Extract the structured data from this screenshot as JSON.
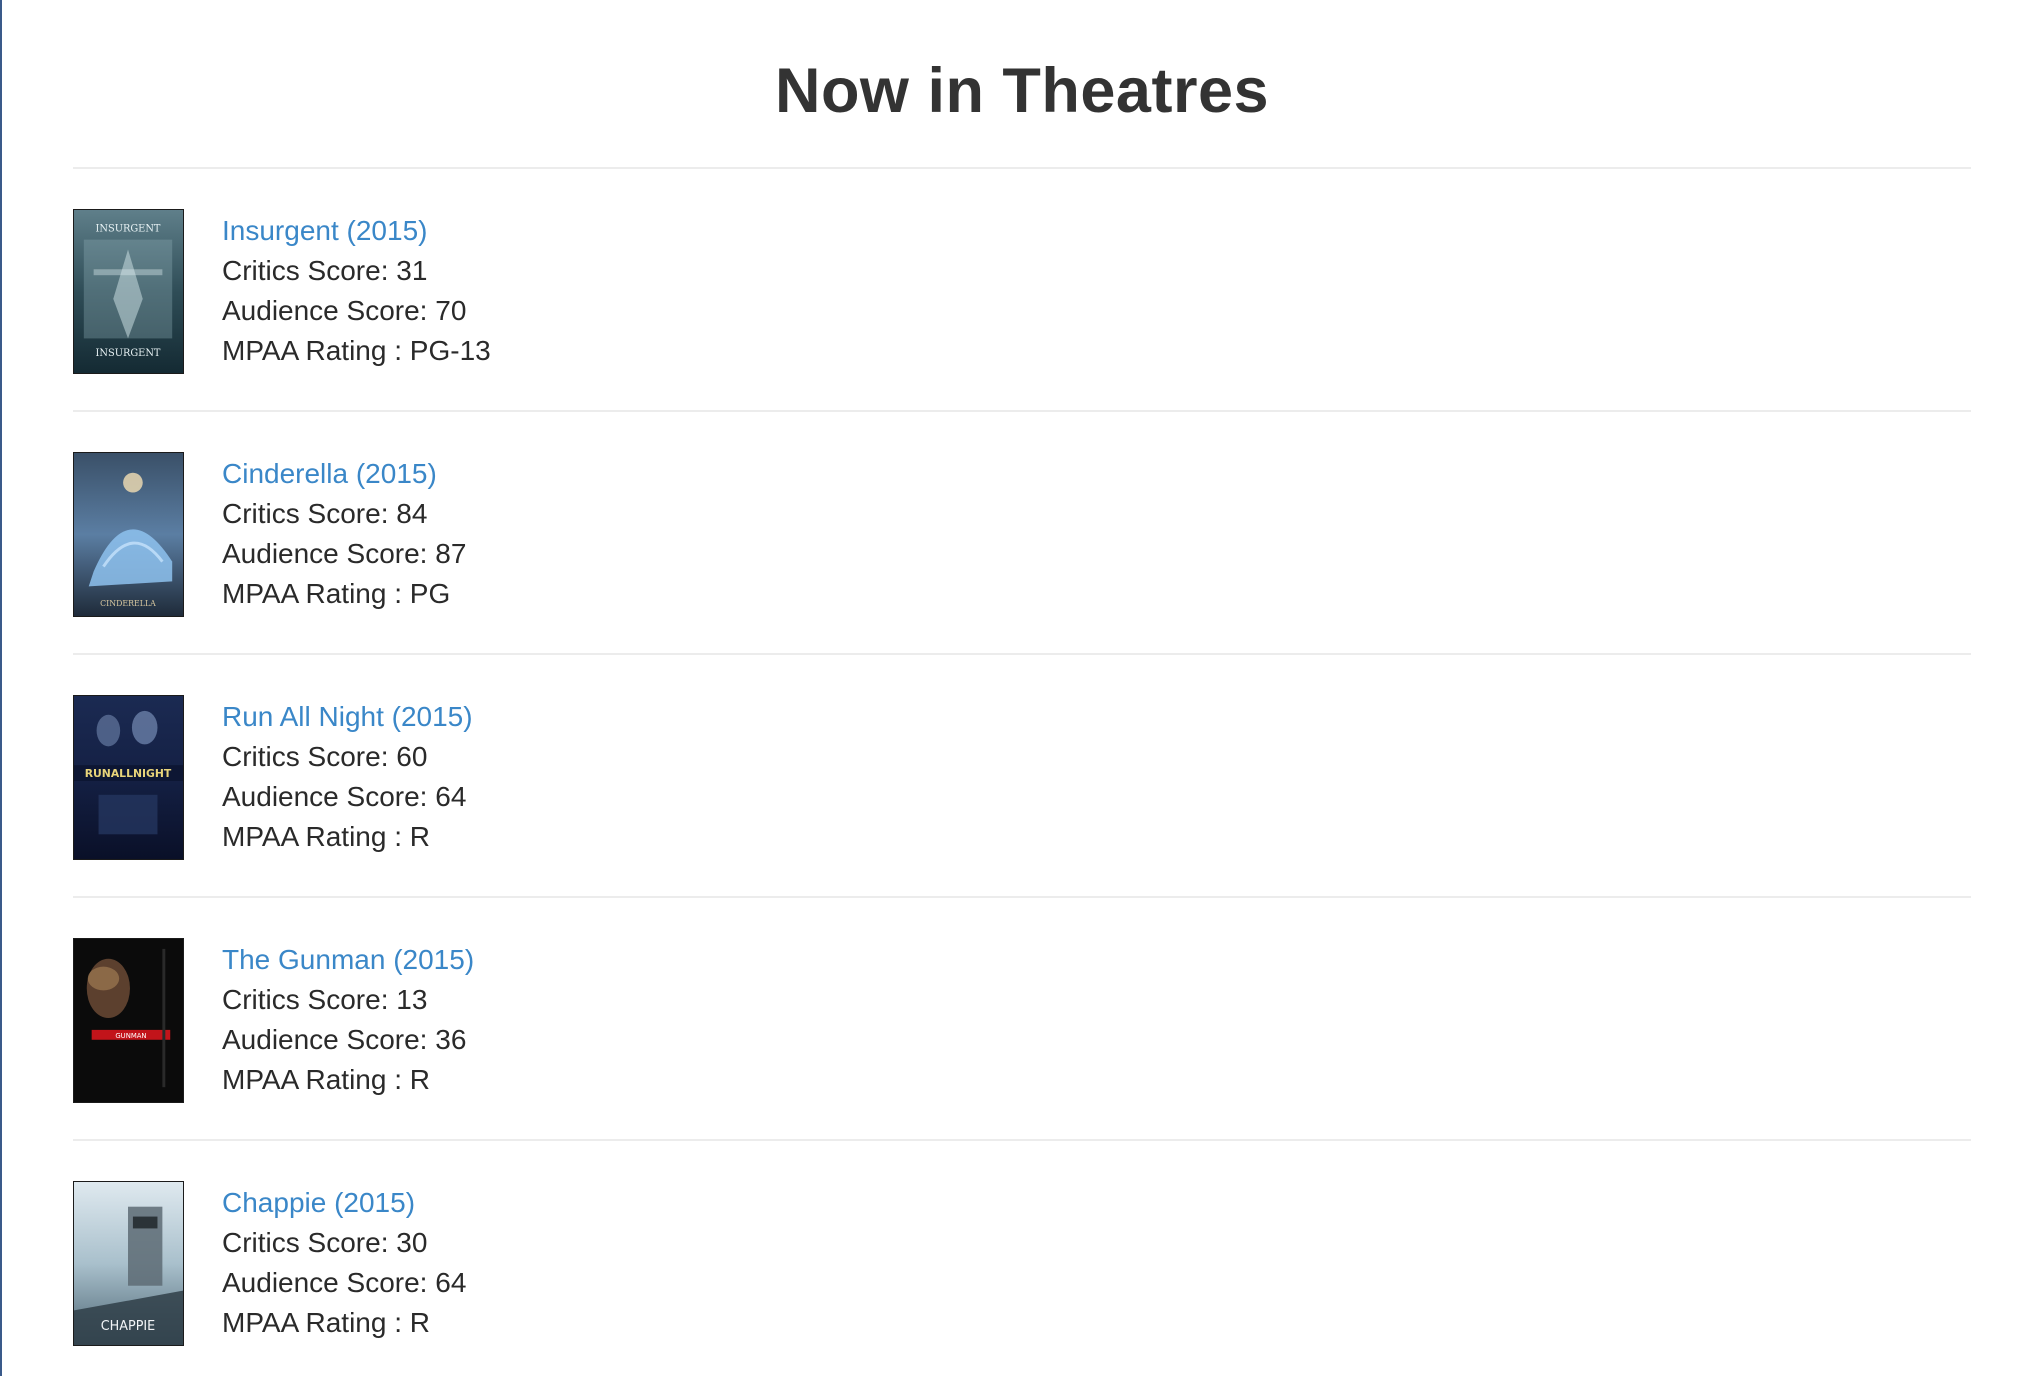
{
  "page": {
    "heading": "Now in Theatres"
  },
  "labels": {
    "critics": "Critics Score: ",
    "audience": "Audience Score: ",
    "mpaa": "MPAA Rating : "
  },
  "movies": [
    {
      "title": "Insurgent (2015)",
      "critics": "31",
      "audience": "70",
      "mpaa": "PG-13",
      "poster_icon": "insurgent-poster",
      "poster_caption": "INSURGENT"
    },
    {
      "title": "Cinderella (2015)",
      "critics": "84",
      "audience": "87",
      "mpaa": "PG",
      "poster_icon": "cinderella-poster",
      "poster_caption": "CINDERELLA"
    },
    {
      "title": "Run All Night (2015)",
      "critics": "60",
      "audience": "64",
      "mpaa": "R",
      "poster_icon": "run-all-night-poster",
      "poster_caption": "RUNALLNIGHT"
    },
    {
      "title": "The Gunman (2015)",
      "critics": "13",
      "audience": "36",
      "mpaa": "R",
      "poster_icon": "gunman-poster",
      "poster_caption": "GUNMAN"
    },
    {
      "title": "Chappie (2015)",
      "critics": "30",
      "audience": "64",
      "mpaa": "R",
      "poster_icon": "chappie-poster",
      "poster_caption": "CHAPPIE"
    }
  ],
  "colors": {
    "link": "#3a87c8",
    "text": "#333333",
    "divider": "#ececec"
  }
}
